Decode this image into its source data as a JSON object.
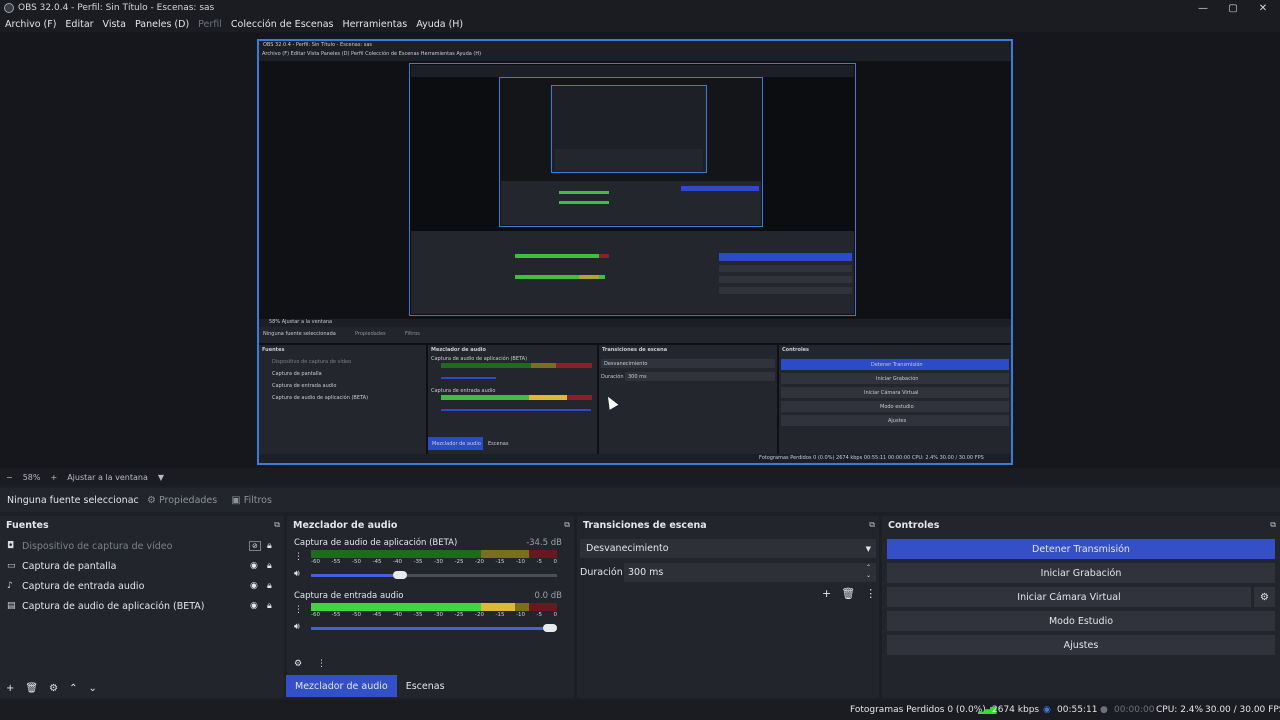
{
  "window": {
    "title": "OBS 32.0.4 - Perfil: Sin Título - Escenas: sas",
    "min": "—",
    "max": "▢",
    "close": "✕"
  },
  "menu": {
    "items": [
      "Archivo (F)",
      "Editar",
      "Vista",
      "Paneles (D)",
      "Perfil",
      "Colección de Escenas",
      "Herramientas",
      "Ayuda (H)"
    ]
  },
  "zoom": {
    "minus": "−",
    "level": "58%",
    "plus": "+",
    "fit": "Ajustar a la ventana",
    "arrow": "▼"
  },
  "sourcebar": {
    "no_source": "Ninguna fuente seleccionac",
    "properties": "Propiedades",
    "filters": "Filtros"
  },
  "sources": {
    "title": "Fuentes",
    "items": [
      {
        "label": "Dispositivo de captura de vídeo",
        "icon": "camera-icon",
        "enabled": false
      },
      {
        "label": "Captura de pantalla",
        "icon": "monitor-icon",
        "enabled": true
      },
      {
        "label": "Captura de entrada audio",
        "icon": "microphone-icon",
        "enabled": true
      },
      {
        "label": "Captura de audio de aplicación (BETA)",
        "icon": "app-audio-icon",
        "enabled": true
      }
    ]
  },
  "mixer": {
    "title": "Mezclador de audio",
    "channels": [
      {
        "name": "Captura de audio de aplicación (BETA)",
        "db": "-34.5 dB",
        "volume": 0.36
      },
      {
        "name": "Captura de entrada audio",
        "db": "0.0 dB",
        "volume": 1.0
      }
    ],
    "ticks": [
      "-60",
      "-55",
      "-50",
      "-45",
      "-40",
      "-35",
      "-30",
      "-25",
      "-20",
      "-15",
      "-10",
      "-5",
      "0"
    ],
    "tabs": [
      "Mezclador de audio",
      "Escenas"
    ]
  },
  "transitions": {
    "title": "Transiciones de escena",
    "selected": "Desvanecimiento",
    "duration_label": "Duración",
    "duration_value": "300 ms"
  },
  "controls": {
    "title": "Controles",
    "stream": "Detener Transmisión",
    "record": "Iniciar Grabación",
    "vcam": "Iniciar Cámara Virtual",
    "studio": "Modo Estudio",
    "settings": "Ajustes"
  },
  "status": {
    "dropped": "Fotogramas Perdidos 0 (0.0%)",
    "bitrate": "2674 kbps",
    "stream_time": "00:55:11",
    "rec_time": "00:00:00",
    "cpu": "CPU: 2.4%",
    "fps": "30.00 / 30.00 FPS"
  },
  "preview": {
    "nested_title": "OBS 32.0.4 - Perfil: Sin Título - Escenas: sas",
    "nested_menu": "Archivo (F)  Editar  Vista  Paneles (D)  Perfil  Colección de Escenas  Herramientas  Ayuda (H)",
    "nested_sources": "Fuentes",
    "nested_mixer": "Mezclador de audio",
    "nested_trans": "Transiciones de escena",
    "nested_controls": "Controles",
    "nested_src": [
      "Dispositivo de captura de vídeo",
      "Captura de pantalla",
      "Captura de entrada audio",
      "Captura de audio de aplicación (BETA)"
    ],
    "nested_stream": "Detener Transmisión",
    "nested_rec": "Iniciar Grabación",
    "nested_vcam": "Iniciar Cámara Virtual",
    "nested_studio": "Modo estudio",
    "nested_settings": "Ajustes",
    "nested_status": "Fotogramas Perdidos 0 (0.0%)   2674 kbps   00:55:11   00:00:00   CPU: 2.4%   30.00 / 30.00 FPS",
    "nested_nosrc": "Ninguna fuente seleccionada",
    "nested_props": "Propiedades",
    "nested_filters": "Filtros",
    "nested_fade": "Desvanecimiento",
    "nested_duration": "Duración",
    "nested_duration_value": "300 ms",
    "nested_zoom": "58%    Ajustar a la ventana",
    "nested_ch1": "Captura de audio de aplicación (BETA)",
    "nested_ch2": "Captura de entrada audio",
    "nested_tab1": "Mezclador de audio",
    "nested_tab2": "Escenas"
  },
  "colors": {
    "accent": "#3350c8",
    "preview_border": "#3b7cd9",
    "meter_green": "#42d63e",
    "meter_yellow": "#e0b834",
    "meter_red": "#6a1820"
  }
}
